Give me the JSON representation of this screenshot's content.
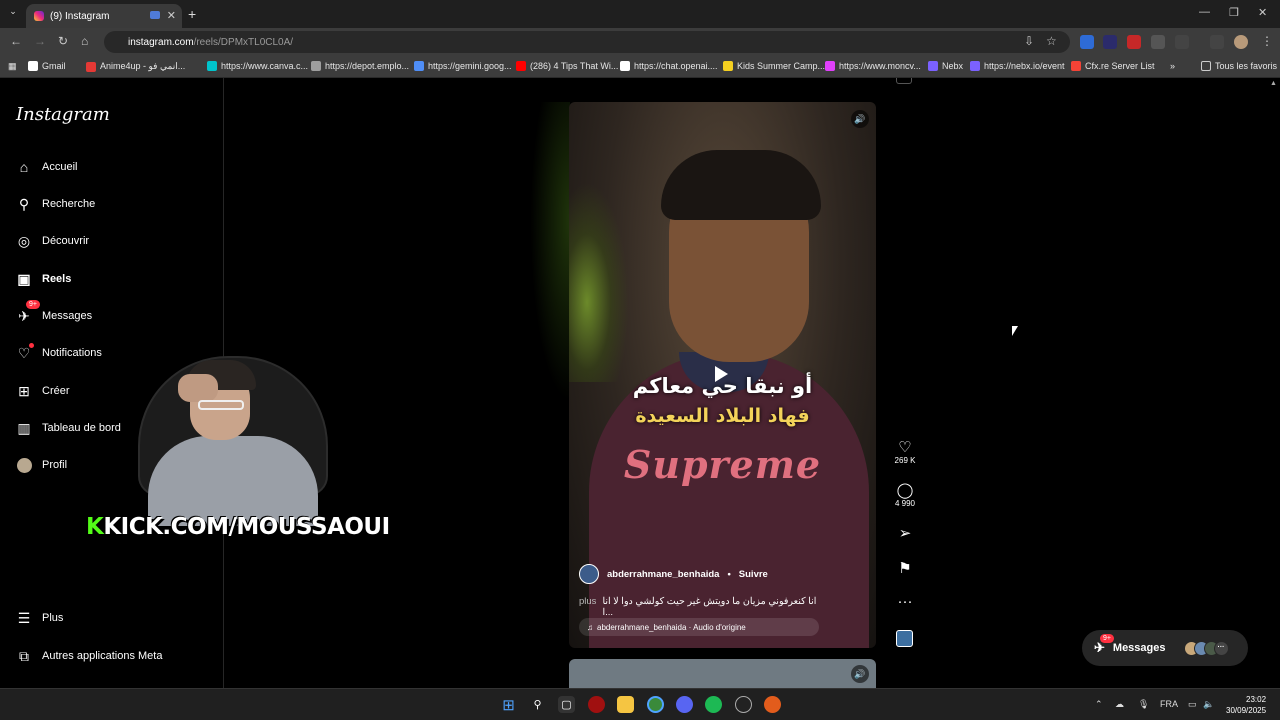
{
  "browser": {
    "tab_title": "(9) Instagram",
    "url_host": "instagram.com",
    "url_path": "/reels/DPMxTL0CL0A/",
    "bookmarks": [
      {
        "label": "Gmail",
        "color": "#ffffff"
      },
      {
        "label": "Anime4up - انمي فو...",
        "color": "#e53935"
      },
      {
        "label": "https://www.canva.c...",
        "color": "#00c4cc"
      },
      {
        "label": "https://depot.emplo...",
        "color": "#9e9e9e"
      },
      {
        "label": "https://gemini.goog...",
        "color": "#4f8ef7"
      },
      {
        "label": "(286) 4 Tips That Wi...",
        "color": "#ff0000"
      },
      {
        "label": "https://chat.openai....",
        "color": "#ffffff"
      },
      {
        "label": "Kids Summer Camp...",
        "color": "#f5d020"
      },
      {
        "label": "https://www.moncv...",
        "color": "#e040fb"
      },
      {
        "label": "Nebx",
        "color": "#7b61ff"
      },
      {
        "label": "https://nebx.io/event",
        "color": "#7b61ff"
      },
      {
        "label": "Cfx.re Server List",
        "color": "#f44336"
      }
    ],
    "all_bookmarks": "Tous les favoris"
  },
  "sidebar": {
    "logo": "Instagram",
    "items": [
      {
        "label": "Accueil",
        "icon": "home-icon",
        "glyph": "⌂"
      },
      {
        "label": "Recherche",
        "icon": "search-icon",
        "glyph": "⚲"
      },
      {
        "label": "Découvrir",
        "icon": "compass-icon",
        "glyph": "◎"
      },
      {
        "label": "Reels",
        "icon": "reels-icon",
        "glyph": "▣"
      },
      {
        "label": "Messages",
        "icon": "messenger-icon",
        "glyph": "✈",
        "badge": "9+"
      },
      {
        "label": "Notifications",
        "icon": "heart-icon",
        "glyph": "♡"
      },
      {
        "label": "Créer",
        "icon": "plus-square-icon",
        "glyph": "⊞"
      },
      {
        "label": "Tableau de bord",
        "icon": "dashboard-icon",
        "glyph": "▥"
      },
      {
        "label": "Profil",
        "icon": "avatar",
        "glyph": ""
      }
    ],
    "more": "Plus",
    "meta_apps": "Autres applications Meta"
  },
  "overlay": {
    "kick_k": "K",
    "kick_text": "KICK.COM/MOUSSAOUI"
  },
  "reel": {
    "caption_white": "أو نبقا حي معاكم",
    "caption_yellow": "فهاد البلاد السعيدة",
    "shirt_brand": "Supreme",
    "username": "abderrahmane_benhaida",
    "separator": "•",
    "follow": "Suivre",
    "caption": "انا كنعرفوني مزيان ما دويتش غير حيت كولشي دوا لا انا ا...",
    "more": "plus",
    "audio": "abderrahmane_benhaida · Audio d'origine",
    "likes": "269 K",
    "comments": "4 990"
  },
  "messages_pill": {
    "label": "Messages",
    "badge": "9+"
  },
  "taskbar": {
    "lang": "FRA",
    "time": "23:02",
    "date": "30/09/2025"
  }
}
